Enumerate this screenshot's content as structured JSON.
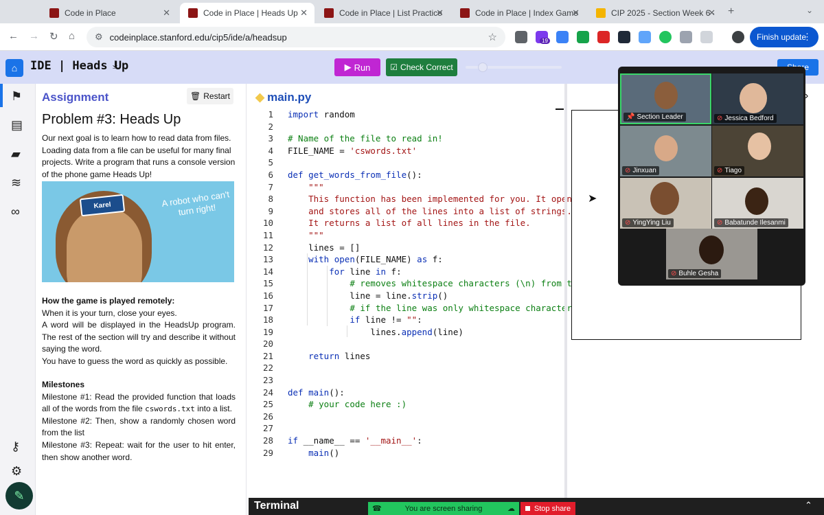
{
  "browser": {
    "tabs": [
      {
        "label": "Code in Place",
        "fav": "red"
      },
      {
        "label": "Code in Place | Heads Up",
        "fav": "red",
        "active": true
      },
      {
        "label": "Code in Place | List Practice",
        "fav": "red"
      },
      {
        "label": "Code in Place | Index Game",
        "fav": "red"
      },
      {
        "label": "CIP 2025 - Section Week 6 -",
        "fav": "yellow"
      }
    ],
    "url": "codeinplace.stanford.edu/cip5/ide/a/headsup",
    "finish_update": "Finish update",
    "extension_badge": "19"
  },
  "ide": {
    "title": "IDE | Heads Up",
    "run_label": "Run",
    "check_label": "Check Correct",
    "share_label": "Share"
  },
  "assignment": {
    "heading": "Assignment",
    "restart_label": "Restart",
    "problem_title": "Problem #3: Heads Up",
    "intro": "Our next goal is to learn how to read data from files. Loading data from a file can be useful for many final projects. Write a program that runs a console version of the phone game Heads Up!",
    "banner_card": "Karel",
    "banner_quote": "A robot who can't turn right!",
    "howto_title": "How the game is played remotely:",
    "howto_lines": [
      "When it is your turn, close your eyes.",
      "A word will be displayed in the HeadsUp program. The rest of the section will try and describe it without saying the word.",
      "You have to guess the word as quickly as possible."
    ],
    "milestones_title": "Milestones",
    "milestone1_pre": "Milestone #1: Read the provided function that loads all of the words from the file ",
    "milestone1_code": "cswords.txt",
    "milestone1_post": " into a list.",
    "milestone2": "Milestone #2: Then, show a randomly chosen word from the list",
    "milestone3": "Milestone #3: Repeat: wait for the user to hit enter, then show another word."
  },
  "editor": {
    "filename": "main.py",
    "lines": [
      "import random",
      "",
      "# Name of the file to read in!",
      "FILE_NAME = 'cswords.txt'",
      "",
      "def get_words_from_file():",
      "    \"\"\"",
      "    This function has been implemented for you. It opens a",
      "    and stores all of the lines into a list of strings.",
      "    It returns a list of all lines in the file.",
      "    \"\"\"",
      "    lines = []",
      "    with open(FILE_NAME) as f:",
      "        for line in f:",
      "            # removes whitespace characters (\\n) from the",
      "            line = line.strip()",
      "            # if the line was only whitespace characters,",
      "            if line != \"\":",
      "                lines.append(line)",
      "",
      "    return lines",
      "",
      "",
      "def main():",
      "    # your code here :)",
      "",
      "",
      "if __name__ == '__main__':",
      "    main()"
    ]
  },
  "terminal": {
    "label": "Terminal"
  },
  "meeting": {
    "participants": [
      {
        "name": "Section Leader",
        "pinned": true
      },
      {
        "name": "Jessica Bedford"
      },
      {
        "name": "Jinxuan"
      },
      {
        "name": "Tiago"
      },
      {
        "name": "YingYing Liu"
      },
      {
        "name": "Babatunde Ilesanmi"
      },
      {
        "name": "Buhle Gesha"
      }
    ],
    "sharing_text": "You are screen sharing",
    "stop_share": "Stop share"
  }
}
